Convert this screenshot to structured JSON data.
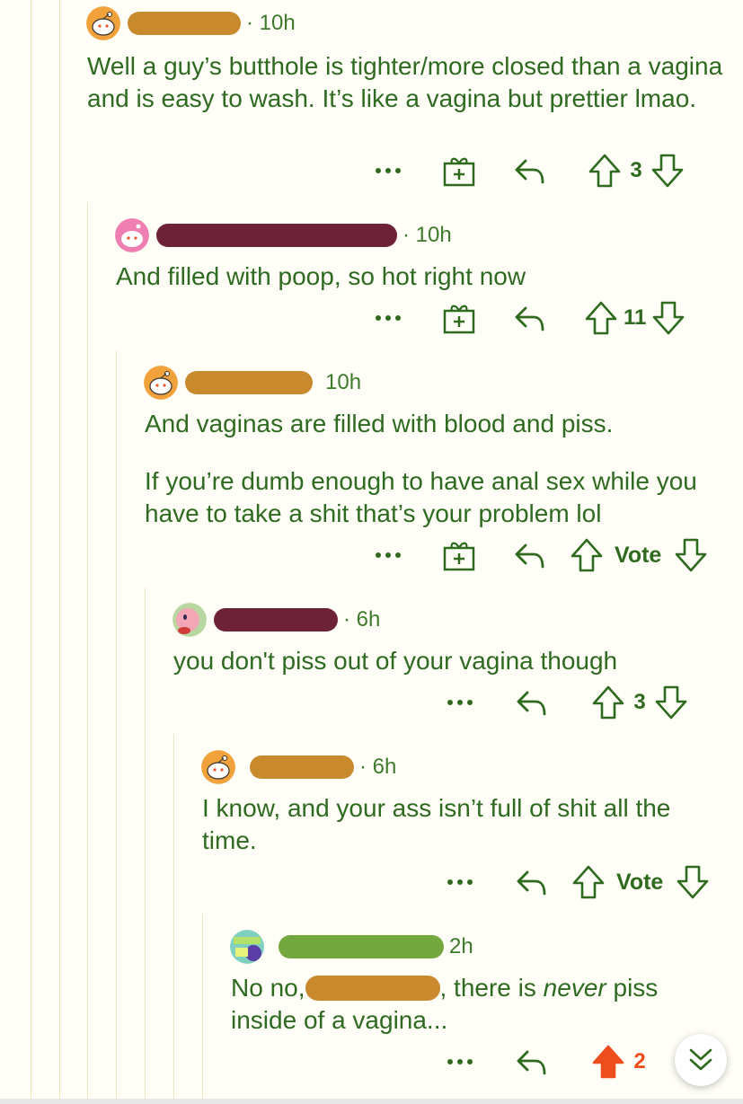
{
  "colors": {
    "text_green": "#2e6a1f",
    "redact_orange": "#c98a2e",
    "redact_maroon": "#6e2238",
    "redact_green": "#73a83e",
    "upvote_active": "#ee4d1d"
  },
  "comments": [
    {
      "time": "· 10h",
      "body": [
        "Well a guy’s butthole is tighter/more closed than a vagina and is easy to wash. It’s like a vagina but prettier lmao."
      ],
      "score": "3",
      "has_award": true
    },
    {
      "time": "· 10h",
      "body": [
        "And filled with poop, so hot right now"
      ],
      "score": "11",
      "has_award": true
    },
    {
      "time": "10h",
      "body": [
        "And vaginas are filled with blood and piss.",
        "If you’re dumb enough to have anal sex while you have to take a shit that’s your problem lol"
      ],
      "score": "Vote",
      "has_award": true
    },
    {
      "time": "· 6h",
      "body": [
        "you don't piss out of your vagina though"
      ],
      "score": "3",
      "has_award": false
    },
    {
      "time": "· 6h",
      "body": [
        "I know, and your ass isn’t full of shit all the time."
      ],
      "score": "Vote",
      "has_award": false
    },
    {
      "time": "2h",
      "body_pre": "No no,",
      "body_mid": ", there is ",
      "body_em": "never",
      "body_post": " piss inside of a vagina...",
      "score": "2",
      "has_award": false,
      "upvoted": true
    }
  ],
  "icons": {
    "more": "more-options-icon",
    "award": "gift-award-icon",
    "reply": "reply-arrow-icon",
    "upvote": "upvote-arrow-icon",
    "downvote": "downvote-arrow-icon",
    "jump": "double-chevron-down-icon"
  }
}
